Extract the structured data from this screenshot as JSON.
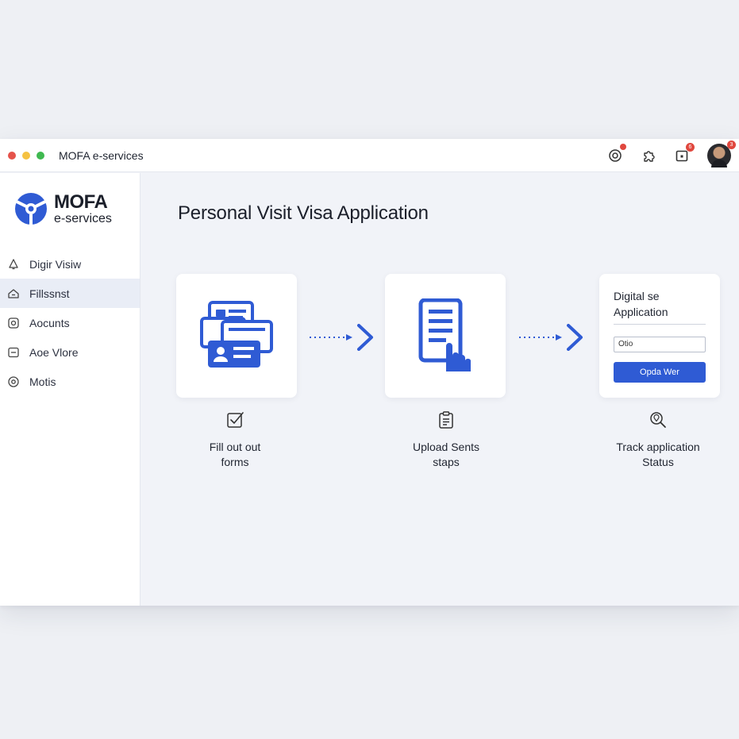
{
  "window": {
    "title": "MOFA e-services",
    "traffic_lights": [
      "#e5534b",
      "#f5c242",
      "#3fb950"
    ],
    "toolbar": [
      {
        "icon": "target-icon",
        "badge": ""
      },
      {
        "icon": "puzzle-icon",
        "badge": ""
      },
      {
        "icon": "square-icon",
        "badge": "6"
      },
      {
        "icon": "avatar",
        "badge": "3"
      }
    ]
  },
  "sidebar": {
    "brand_name": "MOFA",
    "brand_sub": "e-services",
    "items": [
      {
        "label": "Digir Visiw",
        "icon": "bell-icon",
        "active": false
      },
      {
        "label": "Fillssnst",
        "icon": "home-icon",
        "active": true
      },
      {
        "label": "Aocunts",
        "icon": "camera-icon",
        "active": false
      },
      {
        "label": "Aoe Vlore",
        "icon": "message-icon",
        "active": false
      },
      {
        "label": "Motis",
        "icon": "radio-icon",
        "active": false
      }
    ]
  },
  "main": {
    "title": "Personal Visit Visa Application",
    "steps": [
      {
        "label_line1": "Fill out out",
        "label_line2": "forms",
        "icon": "check-form-icon"
      },
      {
        "label_line1": "Upload Sents",
        "label_line2": "staps",
        "icon": "clipboard-icon"
      },
      {
        "label_line1": "Track application",
        "label_line2": "Status",
        "icon": "search-location-icon"
      }
    ],
    "status_card": {
      "title_line1": "Digital se",
      "title_line2": "Application",
      "input_value": "Otio",
      "button_label": "Opda Wer"
    }
  },
  "colors": {
    "accent": "#2f5bd4",
    "sidebar_active": "#e9edf6",
    "badge": "#e0473e"
  }
}
